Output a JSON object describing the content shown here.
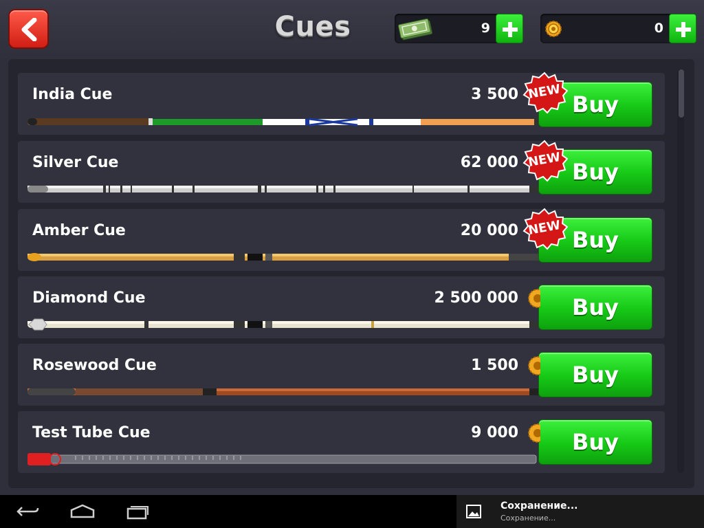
{
  "header": {
    "title": "Cues",
    "back_icon": "back-arrow-icon",
    "cash": {
      "icon": "cash-icon",
      "amount": "9"
    },
    "coins": {
      "icon": "coin-icon",
      "amount": "0"
    },
    "add_icon": "plus-icon"
  },
  "cues": [
    {
      "name": "India Cue",
      "price": "3 500",
      "badge": "NEW",
      "buy_label": "Buy"
    },
    {
      "name": "Silver Cue",
      "price": "62 000",
      "badge": "NEW",
      "buy_label": "Buy"
    },
    {
      "name": "Amber Cue",
      "price": "20 000",
      "badge": "NEW",
      "buy_label": "Buy"
    },
    {
      "name": "Diamond Cue",
      "price": "2 500 000",
      "badge": "coin-icon",
      "buy_label": "Buy"
    },
    {
      "name": "Rosewood Cue",
      "price": "1 500",
      "badge": "coin-icon",
      "buy_label": "Buy"
    },
    {
      "name": "Test Tube Cue",
      "price": "9 000",
      "badge": "coin-icon",
      "buy_label": "Buy"
    }
  ],
  "system_bar": {
    "icons": [
      "back-icon",
      "home-icon",
      "recent-apps-icon"
    ],
    "notification": {
      "icon": "image-icon",
      "title": "Сохранение...",
      "subtitle": "Сохранение..."
    }
  },
  "colors": {
    "accent_green": "#16c816",
    "back_red": "#e02a1c",
    "badge_red": "#d41616",
    "background": "#2f2f3b"
  }
}
